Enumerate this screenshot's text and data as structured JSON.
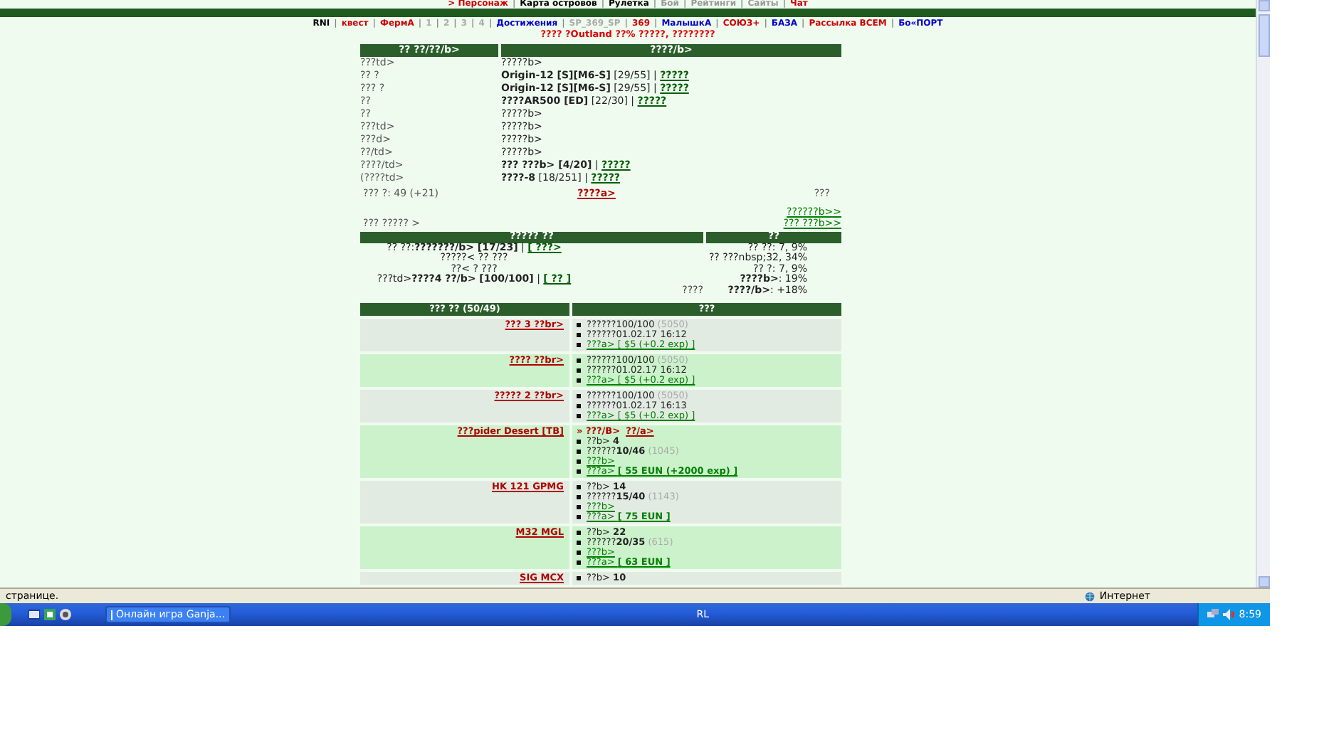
{
  "top_menu": {
    "separator": "|",
    "items": [
      {
        "label": "> Персонаж",
        "color": "#cc0000"
      },
      {
        "label": "Карта островов",
        "color": "#000000"
      },
      {
        "label": "Рулетка",
        "color": "#000000"
      },
      {
        "label": "Бой",
        "color": "#999999"
      },
      {
        "label": "Рейтинги",
        "color": "#999999"
      },
      {
        "label": "Сайты",
        "color": "#999999"
      },
      {
        "label": "Чат",
        "color": "#cc0000"
      }
    ]
  },
  "nav": {
    "separator": "|",
    "items": [
      {
        "label": "RNI",
        "color": "#000000"
      },
      {
        "label": "квест",
        "color": "#cc0000"
      },
      {
        "label": "ФермА",
        "color": "#cc0000"
      },
      {
        "label": "1",
        "color": "#aaaaaa"
      },
      {
        "label": "2",
        "color": "#aaaaaa"
      },
      {
        "label": "3",
        "color": "#aaaaaa"
      },
      {
        "label": "4",
        "color": "#aaaaaa"
      },
      {
        "label": "Достижения",
        "color": "#0000cc"
      },
      {
        "label": "SP_369_SP",
        "color": "#aaaaaa"
      },
      {
        "label": "369",
        "color": "#cc0000"
      },
      {
        "label": "МалышкА",
        "color": "#0000cc"
      },
      {
        "label": "СОЮЗ+",
        "color": "#cc0000"
      },
      {
        "label": "БАЗА",
        "color": "#0000cc"
      },
      {
        "label": "Рассылка ВСЕМ",
        "color": "#cc0000"
      },
      {
        "label": "Бо«ПОРТ",
        "color": "#0000cc"
      }
    ]
  },
  "banner": "???? ?Outland ??% ?????, ????????",
  "info_table": {
    "columns": [
      "?? ??/??/b>",
      "????/b>"
    ],
    "rows": [
      {
        "label": "???td>",
        "value": "?????b>"
      },
      {
        "label": "?? ?",
        "value": "**Origin-12 [S][M6-S]** [29/55] |",
        "link": "?????"
      },
      {
        "label": "??? ?",
        "value": "**Origin-12 [S][M6-S]** [29/55] |",
        "link": "?????"
      },
      {
        "label": "??",
        "value": "**????AR500 [ED]** [22/30] |",
        "link": "?????"
      },
      {
        "label": "??",
        "value": "?????b>"
      },
      {
        "label": "???td>",
        "value": "?????b>"
      },
      {
        "label": "???d>",
        "value": "?????b>"
      },
      {
        "label": "??/td>",
        "value": "?????b>"
      },
      {
        "label": "????/td>",
        "value": "**??? ???b> [4/20]** |",
        "link": "?????"
      },
      {
        "label": "(????td>",
        "value": "**????-8** [18/251] |",
        "link": "?????"
      }
    ]
  },
  "stats": {
    "level": "??? ?: 49 (+21)",
    "link": "????a>",
    "right": "???"
  },
  "links": {
    "left": "??? ????? >",
    "right": [
      "??????b>>",
      "??? ???b>>"
    ]
  },
  "skills": {
    "columns": [
      "????? ??",
      "??"
    ],
    "left": [
      {
        "value": "?? ??:**???????/b> [17/23]** |",
        "link": "[ ???>"
      },
      {
        "value": "?????< ?? ???"
      },
      {
        "value": "??< ? ???"
      },
      {
        "value": "???td>**????4 ??/b> [100/100]** |",
        "link": "[ ?? ]"
      }
    ],
    "note": "????",
    "right": [
      "?? ??: 7, 9%",
      "?? ???nbsp;32, 34%",
      "?? ?: 7, 9%",
      "**????b>**: 19%",
      "**????/b>**: +18%"
    ]
  },
  "items_table": {
    "columns": [
      "??? ?? (50/49)",
      "???"
    ],
    "rows": [
      {
        "name": "??? 3 ??br>",
        "highlighted": false,
        "lines": [
          {
            "kind": "text",
            "text": "??????100/100",
            "note": "(5050)"
          },
          {
            "kind": "text",
            "text": "??????01.02.17 16:12"
          },
          {
            "kind": "link",
            "text": "???a> [ $5 (+0.2 exp) ]"
          }
        ]
      },
      {
        "name": "???? ??br>",
        "highlighted": true,
        "lines": [
          {
            "kind": "text",
            "text": "??????100/100",
            "note": "(5050)"
          },
          {
            "kind": "text",
            "text": "??????01.02.17 16:12"
          },
          {
            "kind": "link",
            "text": "???a> [ $5 (+0.2 exp) ]"
          }
        ]
      },
      {
        "name": "????? 2 ??br>",
        "highlighted": false,
        "lines": [
          {
            "kind": "text",
            "text": "??????100/100",
            "note": "(5050)"
          },
          {
            "kind": "text",
            "text": "??????01.02.17 16:13"
          },
          {
            "kind": "link",
            "text": "???a> [ $5 (+0.2 exp) ]"
          }
        ]
      },
      {
        "name": "???pider Desert [TB]",
        "highlighted": true,
        "header": {
          "text": "» ???/B>",
          "link": "??/a>"
        },
        "lines": [
          {
            "kind": "text",
            "text": "??b> **4**"
          },
          {
            "kind": "text",
            "text": "??????**10/46**",
            "note": "(1045)"
          },
          {
            "kind": "link",
            "text": "???b>"
          },
          {
            "kind": "link",
            "text": "???a> **[ 55 EUN (+2000 exp) ]**"
          }
        ]
      },
      {
        "name": "HK 121 GPMG",
        "highlighted": false,
        "lines": [
          {
            "kind": "text",
            "text": "??b> **14**"
          },
          {
            "kind": "text",
            "text": "??????**15/40**",
            "note": "(1143)"
          },
          {
            "kind": "link",
            "text": "???b>"
          },
          {
            "kind": "link",
            "text": "???a> **[ 75 EUN ]**"
          }
        ]
      },
      {
        "name": "M32 MGL",
        "highlighted": true,
        "lines": [
          {
            "kind": "text",
            "text": "??b> **22**"
          },
          {
            "kind": "text",
            "text": "??????**20/35**",
            "note": "(615)"
          },
          {
            "kind": "link",
            "text": "???b>"
          },
          {
            "kind": "link",
            "text": "???a> **[ 63 EUN ]**"
          }
        ]
      },
      {
        "name": "SIG MCX",
        "highlighted": false,
        "lines": [
          {
            "kind": "text",
            "text": "??b> **10**"
          }
        ]
      }
    ]
  },
  "status_bar": {
    "text": "страницe.",
    "zone": "Интернет"
  },
  "taskbar": {
    "task": "Онлайн игра Ganja...",
    "language": "RL",
    "time": "8:59"
  }
}
